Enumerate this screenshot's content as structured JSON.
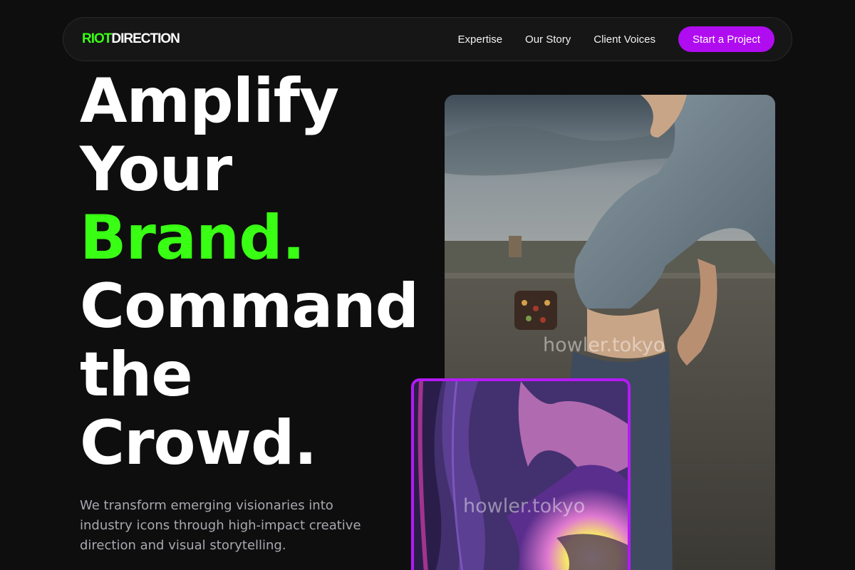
{
  "brand": {
    "part1": "RIOT",
    "part2": "DIRECTION",
    "accent_color": "#39ff14"
  },
  "nav": {
    "links": [
      "Expertise",
      "Our Story",
      "Client Voices"
    ],
    "cta_label": "Start a Project",
    "cta_color": "#b00cf0"
  },
  "hero": {
    "line1": "Amplify",
    "line2": "Your",
    "line3_word": "Brand",
    "line3_dot": ".",
    "line4": "Command",
    "line5": "the",
    "line6_word": "Crowd",
    "line6_dot": ".",
    "subtext": "We transform emerging visionaries into industry icons through high-impact creative direction and visual storytelling."
  },
  "media": {
    "main_photo_watermark": "howler.tokyo",
    "art_card_watermark": "howler.tokyo",
    "art_card_border_color": "#b41af5"
  }
}
